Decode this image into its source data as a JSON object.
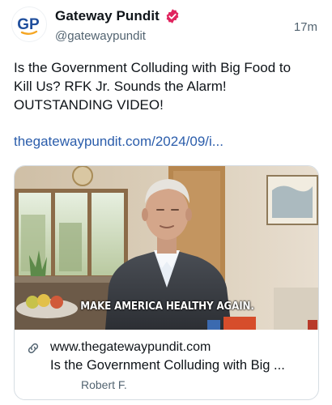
{
  "post": {
    "avatar_text": "GP",
    "display_name": "Gateway Pundit",
    "handle": "@gatewaypundit",
    "time": "17m",
    "text_line1": "Is the Government Colluding with Big Food to",
    "text_line2": "Kill Us? RFK Jr. Sounds the Alarm!",
    "text_line3": "OUTSTANDING VIDEO!",
    "link": "thegatewaypundit.com/2024/09/i..."
  },
  "card": {
    "subtitle": "MAKE AMERICA HEALTHY AGAIN.",
    "domain": "www.thegatewaypundit.com",
    "title": "Is the Government Colluding with Big ...",
    "author": "Robert F."
  },
  "icons": {
    "verified": "verified-badge-icon",
    "link": "link-chain-icon"
  },
  "colors": {
    "brand_blue": "#1f4e9c",
    "brand_orange": "#f5a623",
    "verified_red": "#e0245e",
    "link_blue": "#2b5dab",
    "muted": "#536471"
  }
}
